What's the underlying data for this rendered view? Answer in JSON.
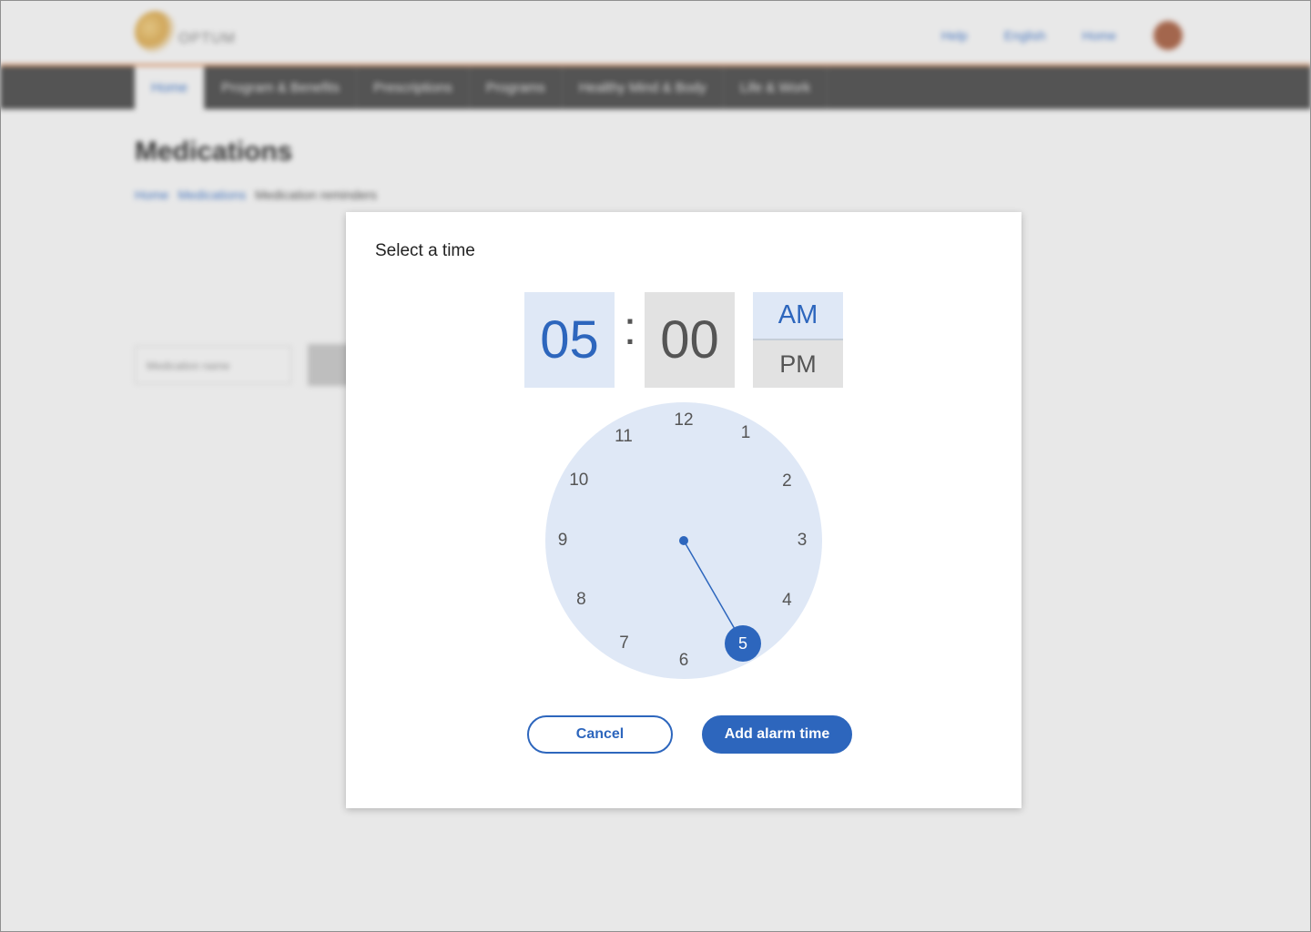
{
  "background": {
    "logo_text": "OPTUM",
    "top_links": [
      "Help",
      "English",
      "Home"
    ],
    "nav": [
      "Home",
      "Program & Benefits",
      "Prescriptions",
      "Programs",
      "Healthy Mind & Body",
      "Life & Work"
    ],
    "page_title": "Medications",
    "breadcrumb": [
      "Home",
      "Medications",
      "Medication reminders"
    ],
    "input_placeholder": "Medication name"
  },
  "modal": {
    "title": "Select a time",
    "hour": "05",
    "separator": ":",
    "minute": "00",
    "am_label": "AM",
    "pm_label": "PM",
    "selected_period": "AM",
    "clock_numbers": [
      "12",
      "1",
      "2",
      "3",
      "4",
      "5",
      "6",
      "7",
      "8",
      "9",
      "10",
      "11"
    ],
    "selected_hour": 5,
    "cancel_label": "Cancel",
    "add_label": "Add alarm time"
  },
  "colors": {
    "accent": "#2d66bd",
    "selected_bg": "#dfe8f6",
    "neutral_bg": "#e2e2e2",
    "text_gray": "#555555",
    "nav_bg": "#555555",
    "header_border": "#e8a679"
  }
}
